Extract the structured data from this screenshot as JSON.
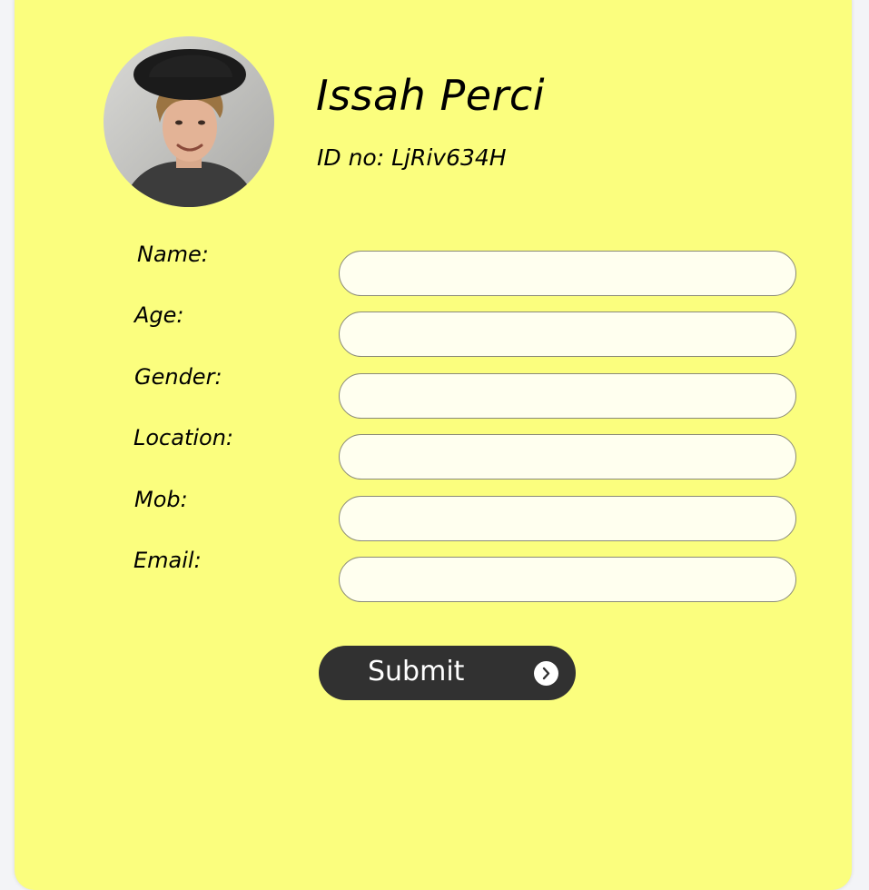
{
  "profile": {
    "name": "Issah Perci",
    "id_line": "ID no: LjRiv634H",
    "avatar": "avatar-photo"
  },
  "form": {
    "fields": [
      {
        "label": "Name:",
        "value": "",
        "placeholder": ""
      },
      {
        "label": "Age:",
        "value": "",
        "placeholder": ""
      },
      {
        "label": "Gender:",
        "value": "",
        "placeholder": ""
      },
      {
        "label": "Location:",
        "value": "",
        "placeholder": ""
      },
      {
        "label": "Mob:",
        "value": "",
        "placeholder": ""
      },
      {
        "label": "Email:",
        "value": "",
        "placeholder": ""
      }
    ],
    "submit_label": "Submit",
    "submit_icon": "chevron-right-icon"
  },
  "colors": {
    "card_background": "#fbfe7e",
    "input_background": "#ffffef",
    "button_background": "#313131",
    "button_text": "#ffffff"
  }
}
